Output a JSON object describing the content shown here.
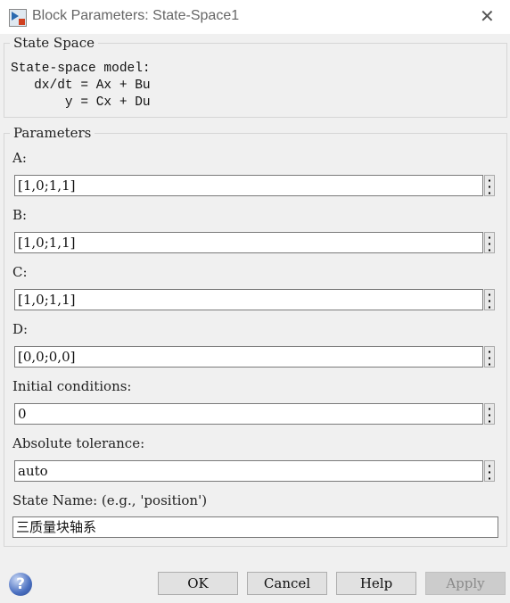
{
  "window": {
    "title": "Block Parameters: State-Space1",
    "close_icon": "close-icon",
    "app_icon": "simulink-block-icon"
  },
  "description": {
    "group_title": "State Space",
    "text": "State-space model:\n   dx/dt = Ax + Bu\n       y = Cx + Du"
  },
  "parameters": {
    "group_title": "Parameters",
    "fields": [
      {
        "label": "A:",
        "value": "[1,0;1,1]"
      },
      {
        "label": "B:",
        "value": "[1,0;1,1]"
      },
      {
        "label": "C:",
        "value": "[1,0;1,1]"
      },
      {
        "label": "D:",
        "value": "[0,0;0,0]"
      },
      {
        "label": "Initial conditions:",
        "value": "0"
      },
      {
        "label": "Absolute tolerance:",
        "value": "auto"
      }
    ],
    "state_name": {
      "label": "State Name: (e.g., 'position')",
      "value": "三质量块轴系"
    },
    "more_icon": "⋮"
  },
  "buttons": {
    "ok": "OK",
    "cancel": "Cancel",
    "help": "Help",
    "apply": "Apply",
    "help_icon": "?"
  }
}
